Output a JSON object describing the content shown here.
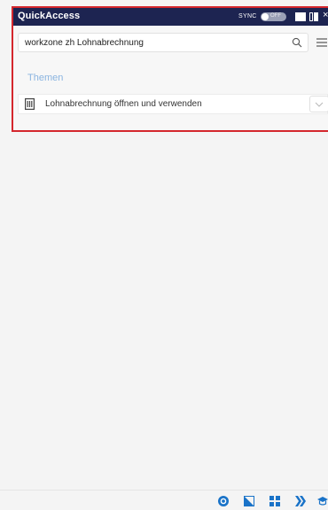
{
  "window": {
    "title": "QuickAccess",
    "sync_label": "SYNC",
    "sync_toggle_text": "OFF",
    "close_glyph": "×"
  },
  "search": {
    "value": "workzone zh Lohnabrechnung",
    "icon": "search-icon"
  },
  "menu": {
    "icon": "hamburger-menu-icon"
  },
  "topics": {
    "title": "Themen",
    "items": [
      {
        "label": "Lohnabrechnung öffnen und verwenden",
        "icon": "document-icon",
        "action_icon": "chevron-down-icon"
      }
    ]
  },
  "footer": {
    "icons": [
      "help-icon",
      "resize-icon",
      "grid-icon",
      "next-icon",
      "learning-icon"
    ]
  },
  "colors": {
    "titlebar": "#1d2451",
    "accent_blue": "#1a73c8",
    "highlight_frame": "#d4272d",
    "section_title": "#8ab4e0"
  }
}
